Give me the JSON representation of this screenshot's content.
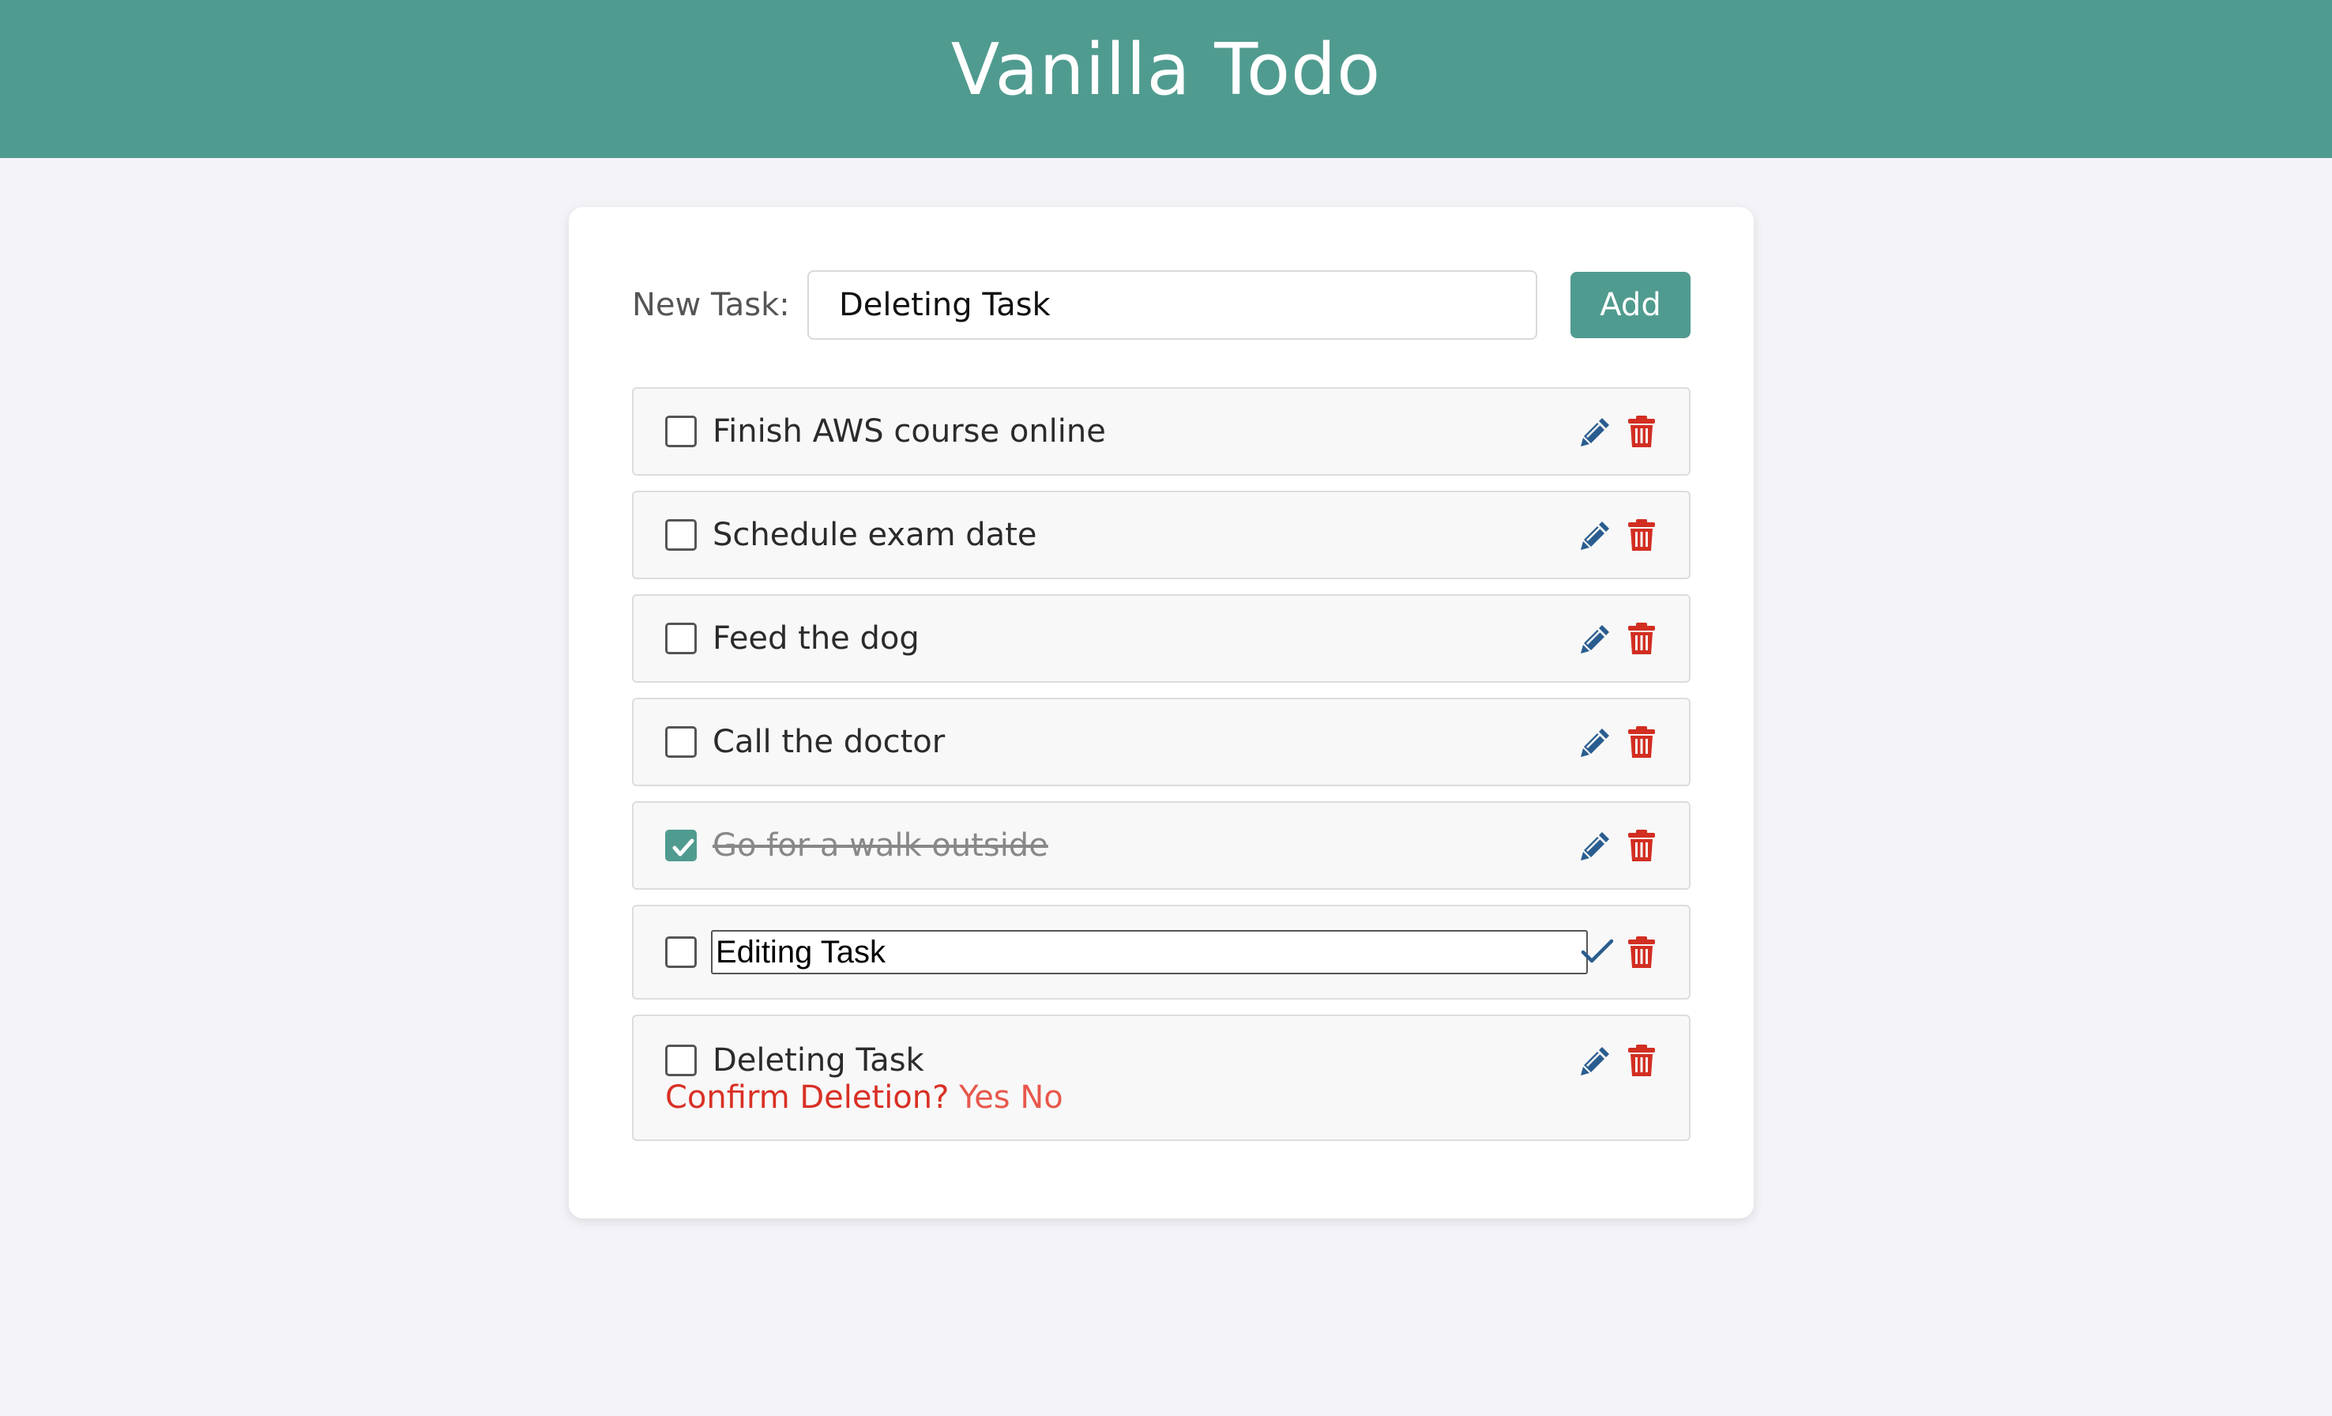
{
  "app": {
    "title": "Vanilla Todo"
  },
  "new_task": {
    "label": "New Task:",
    "value": "Deleting Task",
    "add_label": "Add"
  },
  "tasks": [
    {
      "label": "Finish AWS course online",
      "done": false,
      "state": "normal"
    },
    {
      "label": "Schedule exam date",
      "done": false,
      "state": "normal"
    },
    {
      "label": "Feed the dog",
      "done": false,
      "state": "normal"
    },
    {
      "label": "Call the doctor",
      "done": false,
      "state": "normal"
    },
    {
      "label": "Go for a walk outside",
      "done": true,
      "state": "normal"
    },
    {
      "label": "Editing Task",
      "done": false,
      "state": "editing"
    },
    {
      "label": "Deleting Task",
      "done": false,
      "state": "confirm-delete"
    }
  ],
  "confirm": {
    "question": "Confirm Deletion?",
    "yes": "Yes",
    "no": "No"
  },
  "colors": {
    "accent": "#509b8f",
    "edit_icon": "#2a5d8f",
    "delete_icon": "#d22e22",
    "confirm_text": "#d93025"
  },
  "icons": {
    "edit": "pencil-icon",
    "delete": "trash-icon",
    "save": "checkmark-icon",
    "checked": "checkmark-icon"
  }
}
